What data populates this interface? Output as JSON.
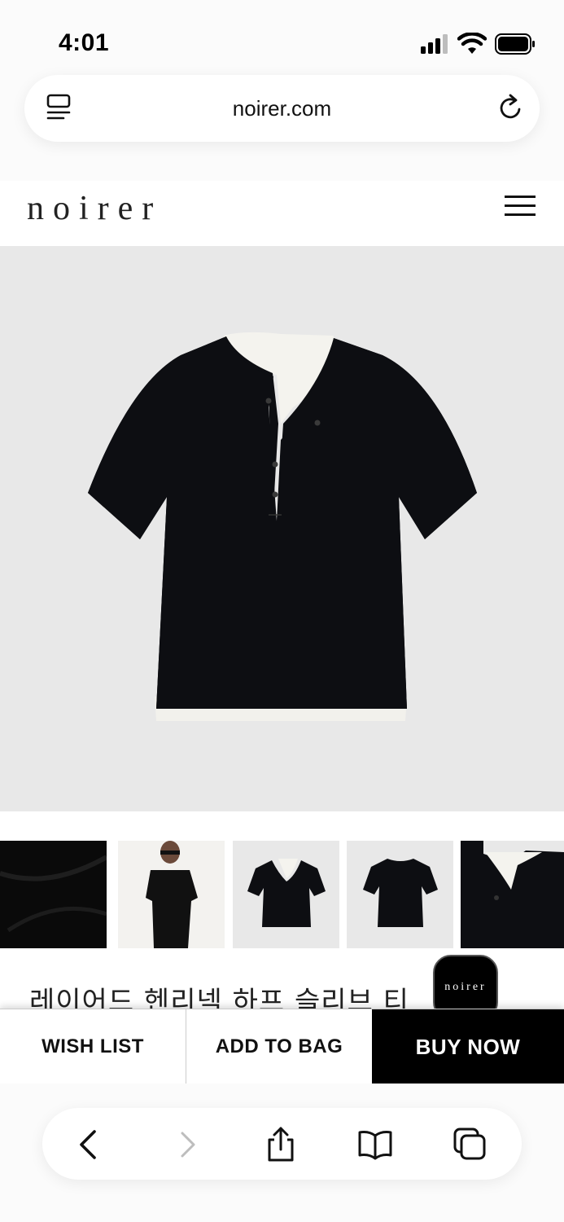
{
  "status_bar": {
    "time": "4:01"
  },
  "browser": {
    "url": "noirer.com"
  },
  "site": {
    "logo": "noirer"
  },
  "product": {
    "title": "레이어드 헨리넥 하프 슬리브 티"
  },
  "badge": {
    "label": "noirer"
  },
  "actions": {
    "wish_list": "WISH LIST",
    "add_to_bag": "ADD TO BAG",
    "buy_now": "BUY NOW"
  },
  "colors": {
    "accent": "#000000",
    "hero_bg": "#e8e8e8",
    "page_bg": "#ffffff"
  },
  "icons": [
    "signal-icon",
    "wifi-icon",
    "battery-icon",
    "tab-menu-icon",
    "reload-icon",
    "hamburger-menu-icon",
    "back-icon",
    "forward-icon",
    "share-icon",
    "bookmarks-icon",
    "tabs-icon"
  ]
}
